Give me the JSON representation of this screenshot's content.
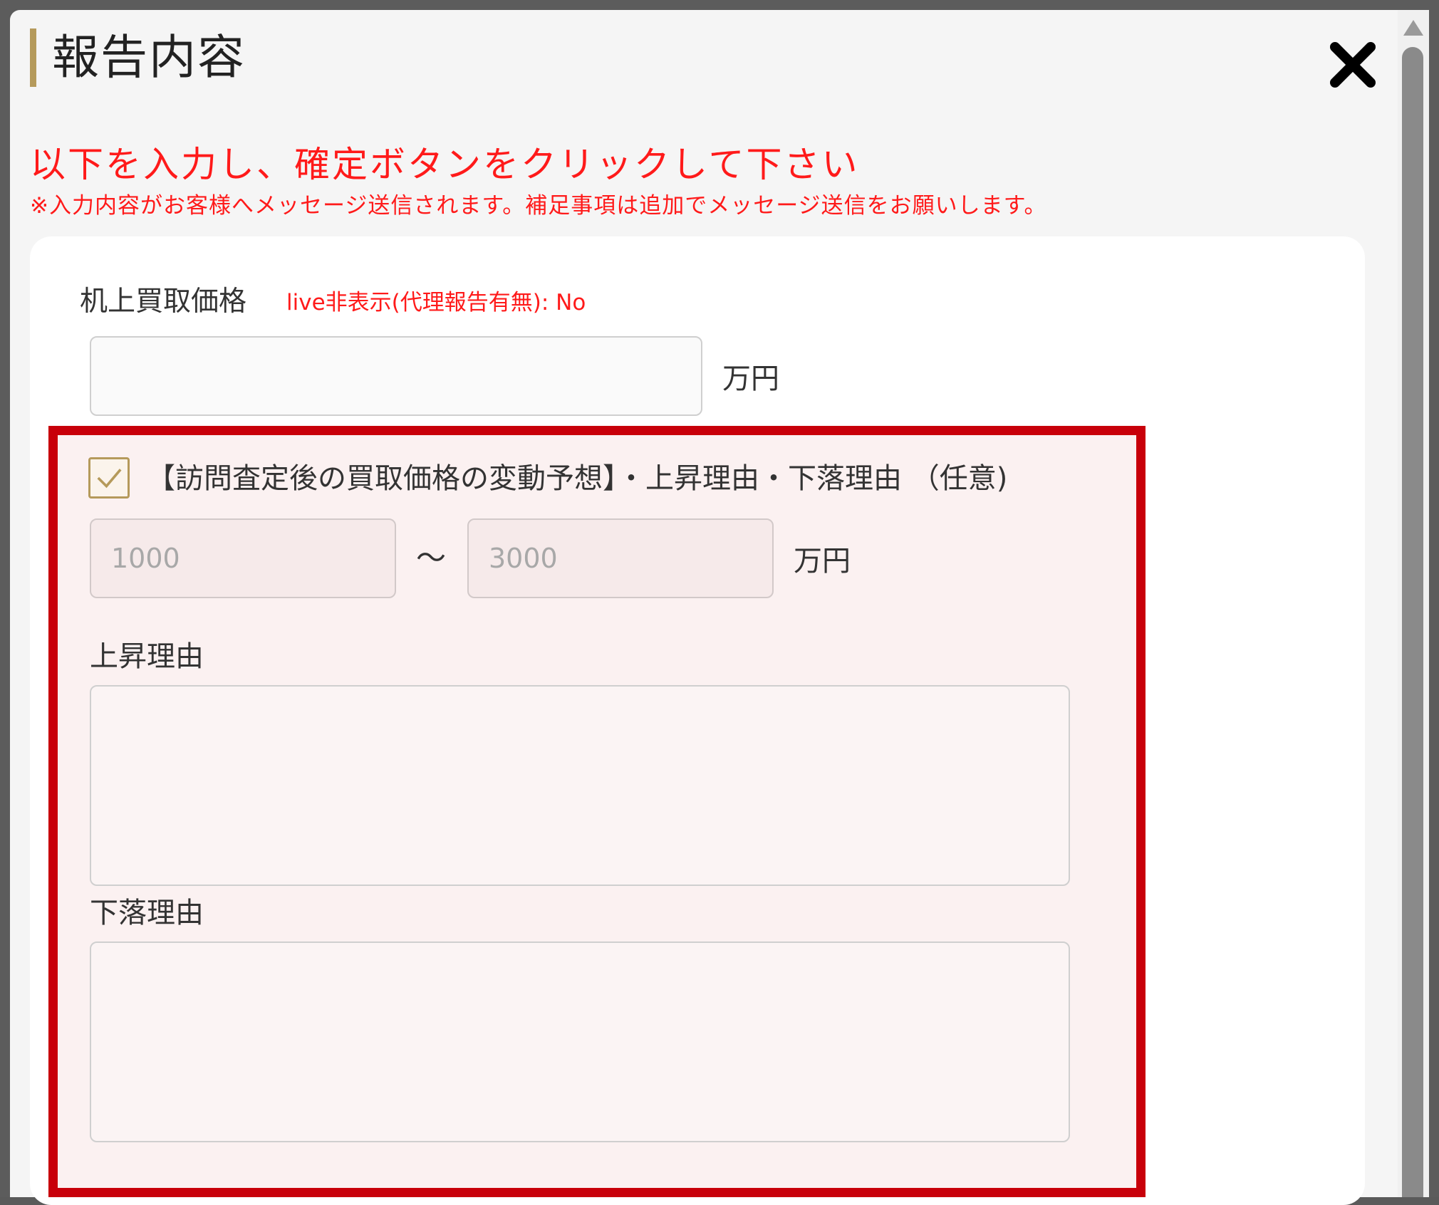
{
  "modal": {
    "title": "報告内容",
    "close_icon": "close-icon"
  },
  "instruction": {
    "main": "以下を入力し、確定ボタンをクリックして下さい",
    "note": "※入力内容がお客様へメッセージ送信されます。補足事項は追加でメッセージ送信をお願いします。"
  },
  "desk_price": {
    "label": "机上買取価格",
    "note": "live非表示(代理報告有無): No",
    "value": "",
    "unit": "万円"
  },
  "forecast": {
    "checked": true,
    "label": "【訪問査定後の買取価格の変動予想】・上昇理由・下落理由 （任意)",
    "min_placeholder": "1000",
    "max_placeholder": "3000",
    "separator": "〜",
    "unit": "万円",
    "rise_label": "上昇理由",
    "fall_label": "下落理由"
  },
  "colors": {
    "accent_gold": "#b59a5b",
    "alert_red": "#ff1a1a",
    "highlight_border": "#c8000a"
  }
}
